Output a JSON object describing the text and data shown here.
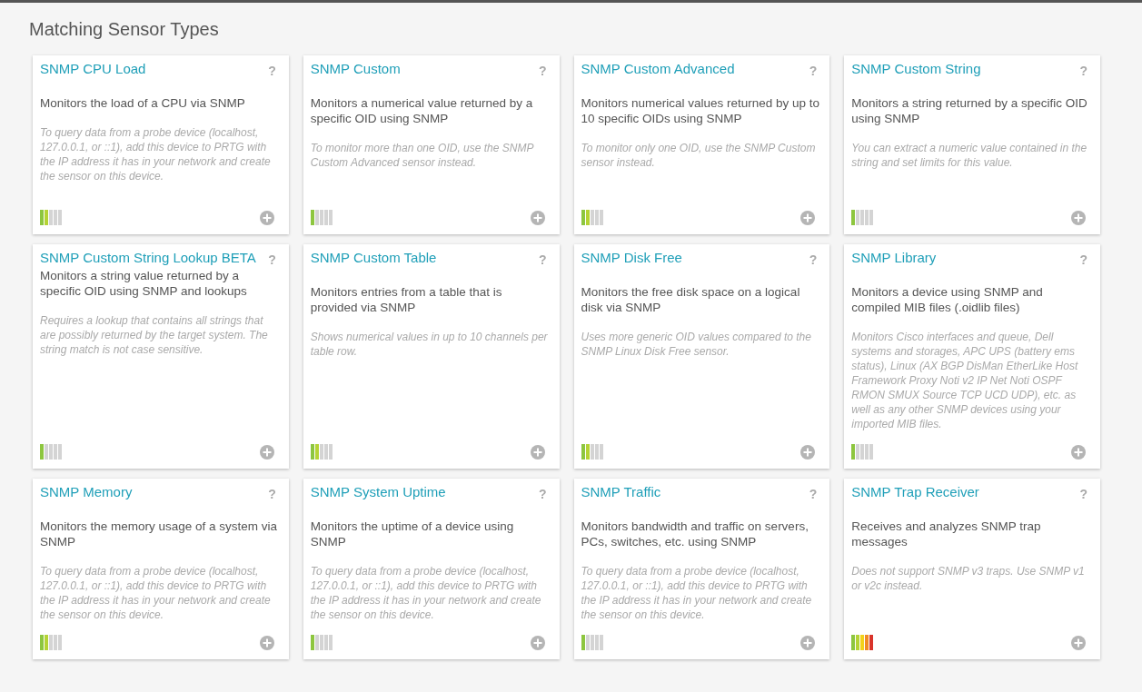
{
  "heading": "Matching Sensor Types",
  "cards": [
    {
      "title": "SNMP CPU Load",
      "help": "?",
      "description": "Monitors the load of a CPU via SNMP",
      "tip": "To query data from a probe device (localhost, 127.0.0.1, or ::1), add this device to PRTG with the IP address it has in your network and create the sensor on this device.",
      "impact_bars": [
        {
          "on": true
        },
        {
          "on": true
        },
        {
          "on": false
        },
        {
          "on": false
        },
        {
          "on": false
        }
      ]
    },
    {
      "title": "SNMP Custom",
      "help": "?",
      "description": "Monitors a numerical value returned by a specific OID using SNMP",
      "tip": "To monitor more than one OID, use the SNMP Custom Advanced sensor instead.",
      "impact_bars": [
        {
          "on": true
        },
        {
          "on": false
        },
        {
          "on": false
        },
        {
          "on": false
        },
        {
          "on": false
        }
      ]
    },
    {
      "title": "SNMP Custom Advanced",
      "help": "?",
      "description": "Monitors numerical values returned by up to 10 specific OIDs using SNMP",
      "tip": "To monitor only one OID, use the SNMP Custom sensor instead.",
      "impact_bars": [
        {
          "on": true
        },
        {
          "on": true
        },
        {
          "on": false
        },
        {
          "on": false
        },
        {
          "on": false
        }
      ]
    },
    {
      "title": "SNMP Custom String",
      "help": "?",
      "description": "Monitors a string returned by a specific OID using SNMP",
      "tip": "You can extract a numeric value contained in the string and set limits for this value.",
      "impact_bars": [
        {
          "on": true
        },
        {
          "on": false
        },
        {
          "on": false
        },
        {
          "on": false
        },
        {
          "on": false
        }
      ]
    },
    {
      "title": "SNMP Custom String Lookup BETA",
      "help": "?",
      "description": "Monitors a string value returned by a specific OID using SNMP and lookups",
      "tip": "Requires a lookup that contains all strings that are possibly returned by the target system. The string match is not case sensitive.",
      "impact_bars": [
        {
          "on": true
        },
        {
          "on": false
        },
        {
          "on": false
        },
        {
          "on": false
        },
        {
          "on": false
        }
      ]
    },
    {
      "title": "SNMP Custom Table",
      "help": "?",
      "description": "Monitors entries from a table that is provided via SNMP",
      "tip": "Shows numerical values in up to 10 channels per table row.",
      "impact_bars": [
        {
          "on": true
        },
        {
          "on": true
        },
        {
          "on": false
        },
        {
          "on": false
        },
        {
          "on": false
        }
      ]
    },
    {
      "title": "SNMP Disk Free",
      "help": "?",
      "description": "Monitors the free disk space on a logical disk via SNMP",
      "tip": "Uses more generic OID values compared to the SNMP Linux Disk Free sensor.",
      "impact_bars": [
        {
          "on": true
        },
        {
          "on": true
        },
        {
          "on": false
        },
        {
          "on": false
        },
        {
          "on": false
        }
      ]
    },
    {
      "title": "SNMP Library",
      "help": "?",
      "description": "Monitors a device using SNMP and compiled MIB files (.oidlib files)",
      "tip": "Monitors Cisco interfaces and queue, Dell systems and storages, APC UPS (battery ems status), Linux (AX BGP DisMan EtherLike Host Framework Proxy Noti v2 IP Net Noti OSPF RMON SMUX Source TCP UCD UDP), etc. as well as any other SNMP devices using your imported MIB files.",
      "impact_bars": [
        {
          "on": true
        },
        {
          "on": false
        },
        {
          "on": false
        },
        {
          "on": false
        },
        {
          "on": false
        }
      ]
    },
    {
      "title": "SNMP Memory",
      "help": "?",
      "description": "Monitors the memory usage of a system via SNMP",
      "tip": "To query data from a probe device (localhost, 127.0.0.1, or ::1), add this device to PRTG with the IP address it has in your network and create the sensor on this device.",
      "impact_bars": [
        {
          "on": true
        },
        {
          "on": true
        },
        {
          "on": false
        },
        {
          "on": false
        },
        {
          "on": false
        }
      ]
    },
    {
      "title": "SNMP System Uptime",
      "help": "?",
      "description": "Monitors the uptime of a device using SNMP",
      "tip": "To query data from a probe device (localhost, 127.0.0.1, or ::1), add this device to PRTG with the IP address it has in your network and create the sensor on this device.",
      "impact_bars": [
        {
          "on": true
        },
        {
          "on": false
        },
        {
          "on": false
        },
        {
          "on": false
        },
        {
          "on": false
        }
      ]
    },
    {
      "title": "SNMP Traffic",
      "help": "?",
      "description": "Monitors bandwidth and traffic on servers, PCs, switches, etc. using SNMP",
      "tip": "To query data from a probe device (localhost, 127.0.0.1, or ::1), add this device to PRTG with the IP address it has in your network and create the sensor on this device.",
      "impact_bars": [
        {
          "on": true
        },
        {
          "on": false
        },
        {
          "on": false
        },
        {
          "on": false
        },
        {
          "on": false
        }
      ]
    },
    {
      "title": "SNMP Trap Receiver",
      "help": "?",
      "description": "Receives and analyzes SNMP trap messages",
      "tip": "Does not support SNMP v3 traps. Use SNMP v1 or v2c instead.",
      "impact_bars": [
        {
          "on": true
        },
        {
          "on": true
        },
        {
          "on": true
        },
        {
          "on": true
        },
        {
          "on": true
        }
      ]
    }
  ]
}
